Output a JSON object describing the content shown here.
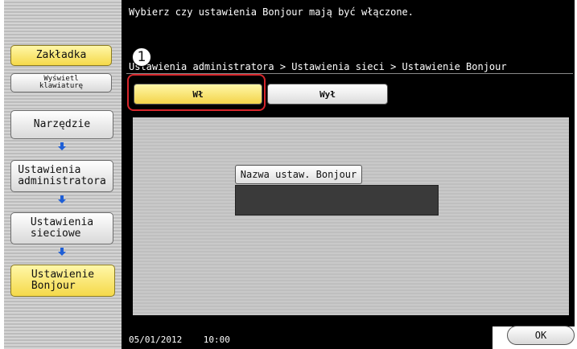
{
  "header": {
    "message": "Wybierz czy ustawienia Bonjour mają być włączone.",
    "breadcrumb": "Ustawienia administratora > Ustawienia sieci > Ustawienie Bonjour"
  },
  "sidebar": {
    "tab_label": "Zakładka",
    "keyboard_label": "Wyświetl\nklawiaturę",
    "steps": [
      {
        "label": "Narzędzie"
      },
      {
        "label": "Ustawienia\nadministratora"
      },
      {
        "label": "Ustawienia\nsieciowe"
      },
      {
        "label": "Ustawienie\nBonjour"
      }
    ]
  },
  "toggle": {
    "on_label": "Wł",
    "off_label": "Wył",
    "selected": "on"
  },
  "callout": {
    "number": "1"
  },
  "bonjour_name": {
    "button_label": "Nazwa ustaw. Bonjour",
    "value": ""
  },
  "footer": {
    "date": "05/01/2012",
    "time": "10:00",
    "ok_label": "OK"
  },
  "colors": {
    "highlight": "#d8262c",
    "selected_fill": "#f3d44a",
    "arrow": "#1f5fd6"
  }
}
